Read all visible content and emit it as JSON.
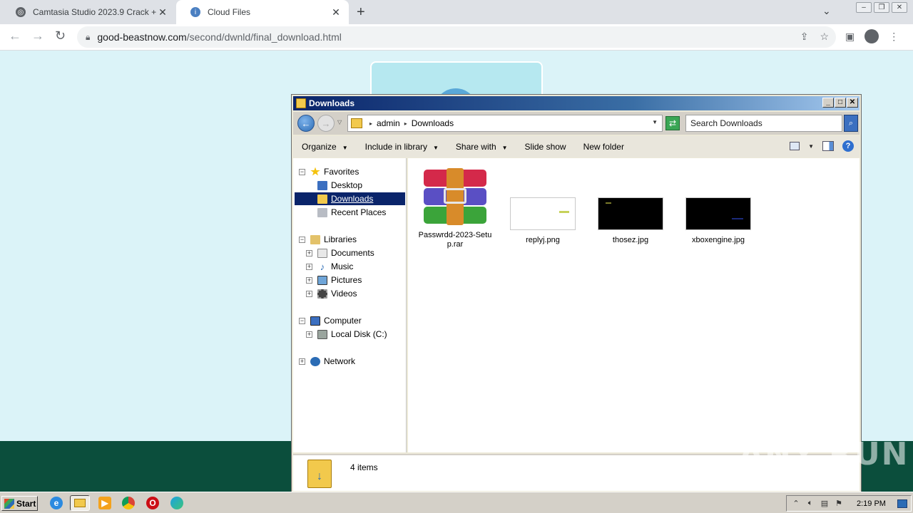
{
  "browser": {
    "tabs": [
      {
        "title": "Camtasia Studio 2023.9 Crack + Ser",
        "close": "✕"
      },
      {
        "title": "Cloud Files",
        "close": "✕"
      }
    ],
    "new_tab": "+",
    "url_host": "good-beastnow.com",
    "url_path": "/second/dwnld/final_download.html"
  },
  "explorer": {
    "title": "Downloads",
    "breadcrumb": [
      "admin",
      "Downloads"
    ],
    "search_placeholder": "Search Downloads",
    "commands": [
      {
        "label": "Organize",
        "dropdown": true
      },
      {
        "label": "Include in library",
        "dropdown": true
      },
      {
        "label": "Share with",
        "dropdown": true
      },
      {
        "label": "Slide show",
        "dropdown": false
      },
      {
        "label": "New folder",
        "dropdown": false
      }
    ],
    "nav": {
      "favorites": "Favorites",
      "desktop": "Desktop",
      "downloads": "Downloads",
      "recent": "Recent Places",
      "libraries": "Libraries",
      "documents": "Documents",
      "music": "Music",
      "pictures": "Pictures",
      "videos": "Videos",
      "computer": "Computer",
      "local_disk": "Local Disk (C:)",
      "network": "Network"
    },
    "files": [
      {
        "name": "Passwrdd-2023-Setup.rar",
        "icon": "winrar-archive-icon"
      },
      {
        "name": "replyj.png",
        "icon": "image-thumbnail"
      },
      {
        "name": "thosez.jpg",
        "icon": "image-thumbnail"
      },
      {
        "name": "xboxengine.jpg",
        "icon": "image-thumbnail"
      }
    ],
    "status": "4 items"
  },
  "watermark": "ANY RUN",
  "taskbar": {
    "start": "Start",
    "clock": "2:19 PM"
  }
}
